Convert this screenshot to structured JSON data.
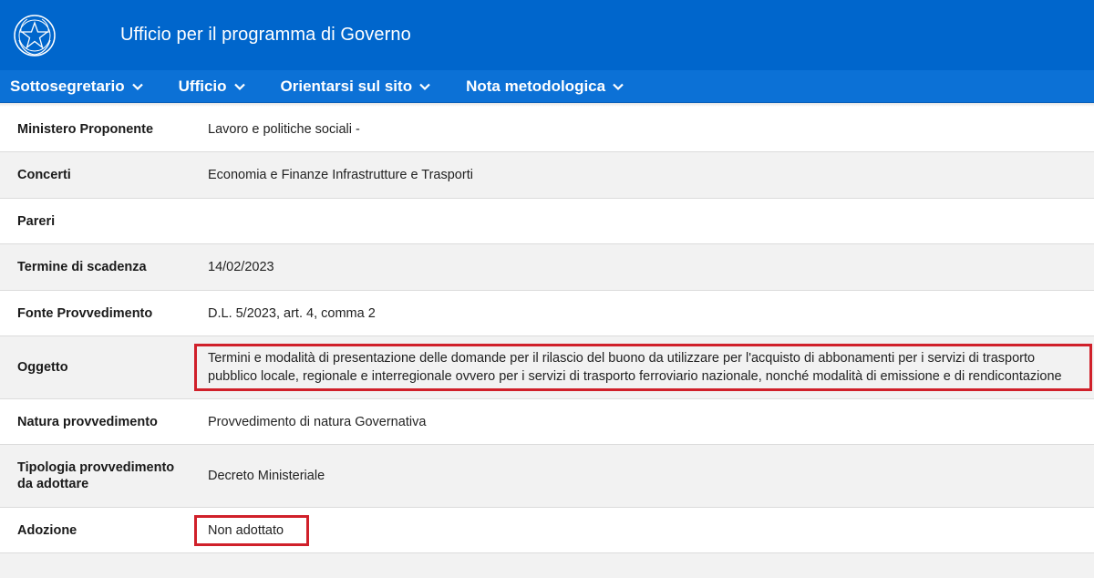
{
  "header": {
    "title": "Ufficio per il programma di Governo"
  },
  "nav": [
    {
      "label": "Sottosegretario"
    },
    {
      "label": "Ufficio"
    },
    {
      "label": "Orientarsi sul sito"
    },
    {
      "label": "Nota metodologica"
    }
  ],
  "rows": [
    {
      "label": "Ministero Proponente",
      "value": "Lavoro e politiche sociali -"
    },
    {
      "label": "Concerti",
      "value": "Economia e Finanze Infrastrutture e Trasporti"
    },
    {
      "label": "Pareri",
      "value": ""
    },
    {
      "label": "Termine di scadenza",
      "value": "14/02/2023"
    },
    {
      "label": "Fonte Provvedimento",
      "value": "D.L. 5/2023, art. 4, comma 2"
    },
    {
      "label": "Oggetto",
      "value": "Termini e modalità di presentazione delle domande per il rilascio del buono da utilizzare per l'acquisto di abbonamenti per i servizi di trasporto pubblico locale, regionale e interregionale ovvero per i servizi di trasporto ferroviario nazionale, nonché modalità di emissione e di rendicontazione"
    },
    {
      "label": "Natura provvedimento",
      "value": "Provvedimento di natura Governativa"
    },
    {
      "label": "Tipologia provvedimento da adottare",
      "value": "Decreto Ministeriale"
    },
    {
      "label": "Adozione",
      "value": "Non adottato"
    }
  ],
  "colors": {
    "header_bg": "#0066cc",
    "nav_bg": "#0c71d6",
    "highlight": "#d0202a"
  }
}
